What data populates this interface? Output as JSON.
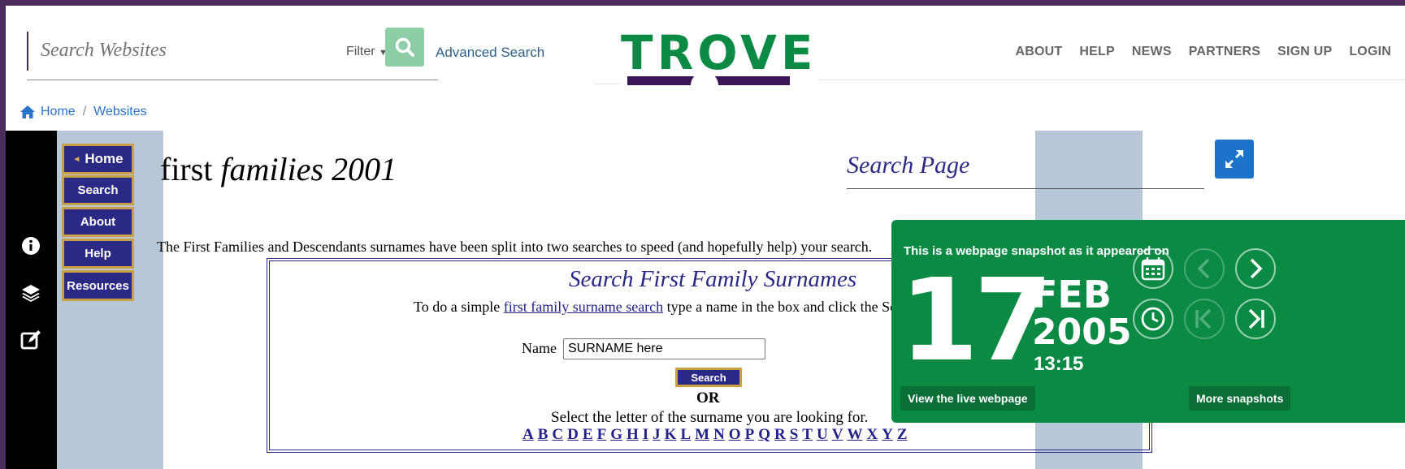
{
  "header": {
    "search_placeholder": "Search Websites",
    "filter_label": "Filter",
    "advanced_search": "Advanced Search",
    "logo_text": "TROVE",
    "nav": [
      "ABOUT",
      "HELP",
      "NEWS",
      "PARTNERS",
      "SIGN UP",
      "LOGIN"
    ]
  },
  "breadcrumb": {
    "home": "Home",
    "sep": "/",
    "current": "Websites"
  },
  "sidebar_icons": [
    "info-icon",
    "layers-icon",
    "edit-icon"
  ],
  "archived_page": {
    "nav_buttons": [
      "Home",
      "Search",
      "About",
      "Help",
      "Resources"
    ],
    "title_plain": "first ",
    "title_italic": "families 2001",
    "search_page_label": "Search Page",
    "intro": "The First Families and Descendants surnames have been split into two searches to speed (and hopefully help) your search.",
    "form": {
      "title": "Search First Family Surnames",
      "line_before": "To do a simple ",
      "line_link": "first family surname search",
      "line_after": " type a name in the box and click the Search button.",
      "name_label": "Name",
      "name_value": "SURNAME here",
      "search_button": "Search",
      "or_text": "OR",
      "select_text": "Select the letter of the surname you are looking for.",
      "letters": [
        "A",
        "B",
        "C",
        "D",
        "E",
        "F",
        "G",
        "H",
        "I",
        "J",
        "K",
        "L",
        "M",
        "N",
        "O",
        "P",
        "Q",
        "R",
        "S",
        "T",
        "U",
        "V",
        "W",
        "X",
        "Y",
        "Z"
      ]
    }
  },
  "snapshot": {
    "caption": "This is a webpage snapshot as it appeared on",
    "day": "17",
    "month": "FEB",
    "year": "2005",
    "time": "13:15",
    "live_button": "View the live webpage",
    "more_button": "More snapshots"
  },
  "colors": {
    "brand_green": "#0b8a44",
    "brand_purple": "#3b1656",
    "link_blue": "#2b72c9",
    "archive_navy": "#2a2a86",
    "archive_gold": "#c9a043"
  }
}
